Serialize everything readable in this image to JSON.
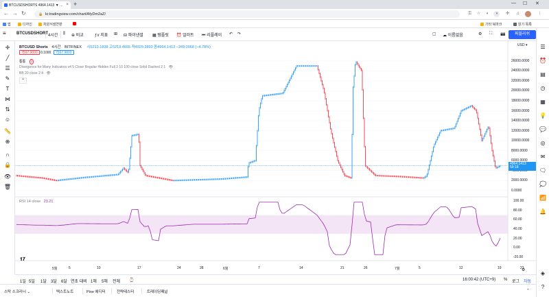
{
  "browser": {
    "tab_title": "BTCUSDSHORTS 4964.1413 ▼ ...",
    "url": "kr.tradingview.com/chart/AfyDm2aZ/",
    "bookmarks": [
      {
        "label": "앱",
        "color": "#4285f4"
      },
      {
        "label": "디자인",
        "color": "#f4b400"
      },
      {
        "label": "차원식썸연판",
        "color": "#f4b400"
      },
      {
        "label": "",
        "color": "#ff0000"
      }
    ],
    "bookmarks_right": [
      "기타 북마크",
      "읽기 목록"
    ]
  },
  "toolbar": {
    "symbol": "BTCUSDSHORT",
    "interval": "4시간",
    "compare": "비교",
    "indicators": "지표",
    "pine": "파이낸셜",
    "templates": "템플릿",
    "alert": "얼러트",
    "replay": "리플레이",
    "save": "이름없음",
    "publish": "퍼블리쉬"
  },
  "legend": {
    "title": "BTCUSD Shorts",
    "interval": "4시간",
    "exchange": "BITFINEX",
    "ohlc": "시5213.1838  고5213.4655  저4929.3893  종4964.1413  −249.0068 (−4.78%)",
    "bid": "7597.9000",
    "spread": "0.1000",
    "ask": "7597.9000",
    "note_label": "통통",
    "note_count": "1",
    "divergence": "Divergence for Many Indicators v4  5  Close  Regular  Hidden  Full  3  10  100  close  Solid  Dashed  2  1",
    "bb": "BB 20 close 2  4"
  },
  "rsi": {
    "label": "RSI 14 close",
    "value": "23.21"
  },
  "price_axis": {
    "currency": "USD",
    "ticks": [
      "26000.0000",
      "24000.0000",
      "22000.0000",
      "20000.0000",
      "18000.0000",
      "16000.0000",
      "14000.0000",
      "12000.0000",
      "10000.0000",
      "8000.0000",
      "6000.0000",
      "4000.0000",
      "2000.0000",
      "0.0000"
    ],
    "last_price": "4964.1413",
    "countdown": "59:18"
  },
  "rsi_axis": {
    "ticks": [
      "100.00",
      "80.00",
      "60.00",
      "40.00",
      "20.00",
      "0.00",
      "-20.00"
    ]
  },
  "time_axis": [
    "5월",
    "5",
    "10",
    "17",
    "24",
    "28",
    "6월",
    "7",
    "14",
    "21",
    "26",
    "7월",
    "5",
    "12",
    "19",
    "23"
  ],
  "ranges": [
    "1일",
    "5일",
    "1달",
    "3달",
    "6달",
    "연초 대비",
    "1해",
    "5해",
    "전체"
  ],
  "clock": "16:00:42 (UTC+9)",
  "scale_opts": [
    "%",
    "로그",
    "자동"
  ],
  "footer": [
    "스탁 스크리너",
    "텍스트노트",
    "Pine 에디터",
    "전략테스터",
    "트레이딩패널"
  ],
  "colors": {
    "up": "#2196f3",
    "down": "#f23645",
    "rsi": "#9c27b0",
    "rsi_band": "#f3e5f5",
    "accent": "#2962ff"
  }
}
